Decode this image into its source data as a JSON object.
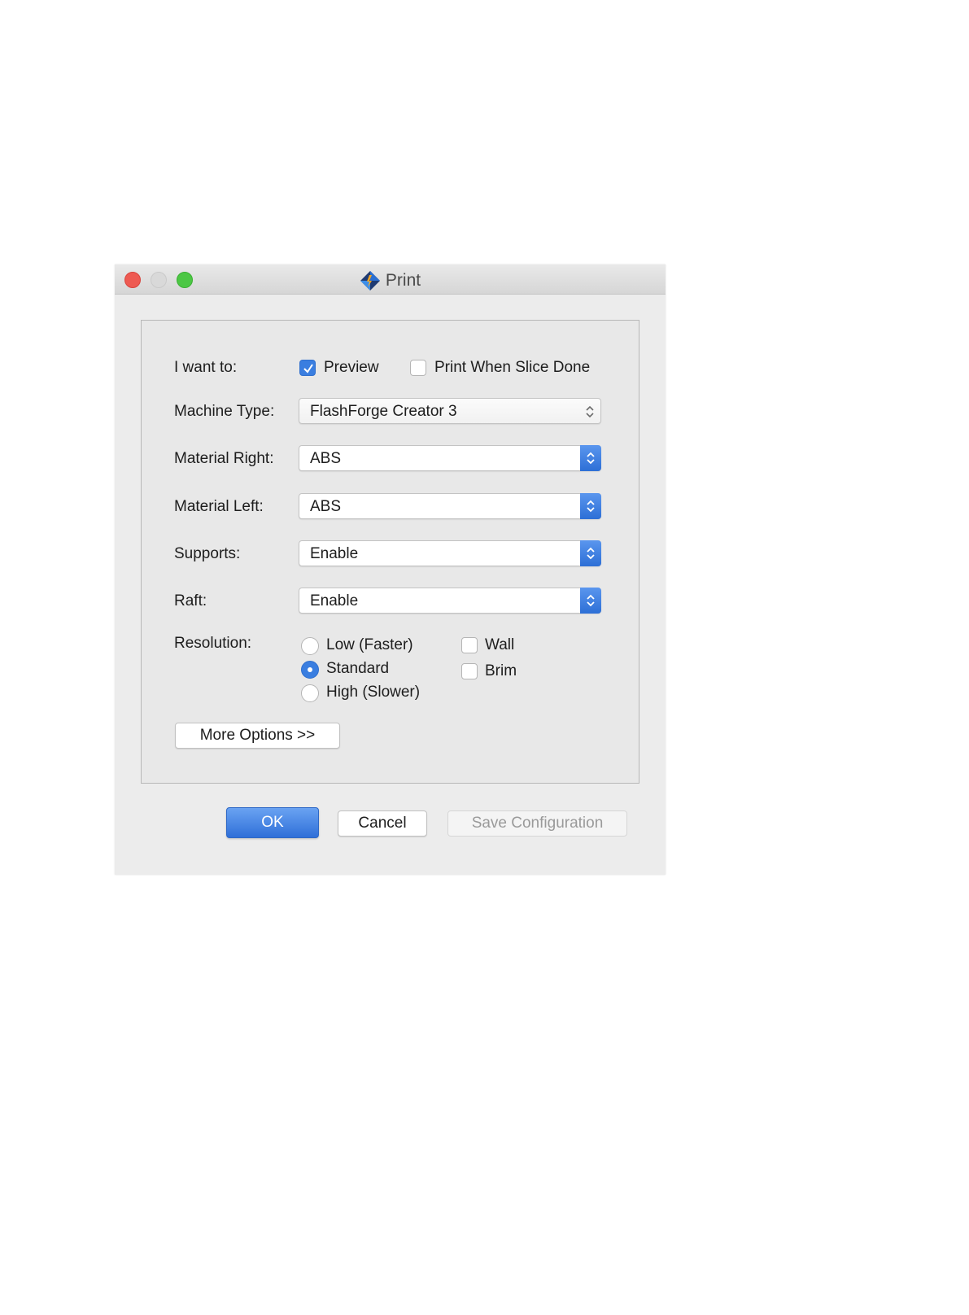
{
  "window": {
    "title": "Print",
    "controls": [
      "close",
      "minimize",
      "zoom"
    ],
    "accent_color": "#3a7ee0"
  },
  "form": {
    "want_label": "I want to:",
    "preview": {
      "label": "Preview",
      "checked": true
    },
    "print_when_done": {
      "label": "Print When Slice Done",
      "checked": false
    },
    "machine_type": {
      "label": "Machine Type:",
      "value": "FlashForge Creator 3"
    },
    "material_right": {
      "label": "Material Right:",
      "value": "ABS"
    },
    "material_left": {
      "label": "Material Left:",
      "value": "ABS"
    },
    "supports": {
      "label": "Supports:",
      "value": "Enable"
    },
    "raft": {
      "label": "Raft:",
      "value": "Enable"
    },
    "resolution": {
      "label": "Resolution:",
      "options": [
        "Low (Faster)",
        "Standard",
        "High (Slower)"
      ],
      "selected": "Standard"
    },
    "wall": {
      "label": "Wall",
      "checked": false
    },
    "brim": {
      "label": "Brim",
      "checked": false
    },
    "more_options": "More Options >>"
  },
  "buttons": {
    "ok": "OK",
    "cancel": "Cancel",
    "save": "Save Configuration"
  }
}
